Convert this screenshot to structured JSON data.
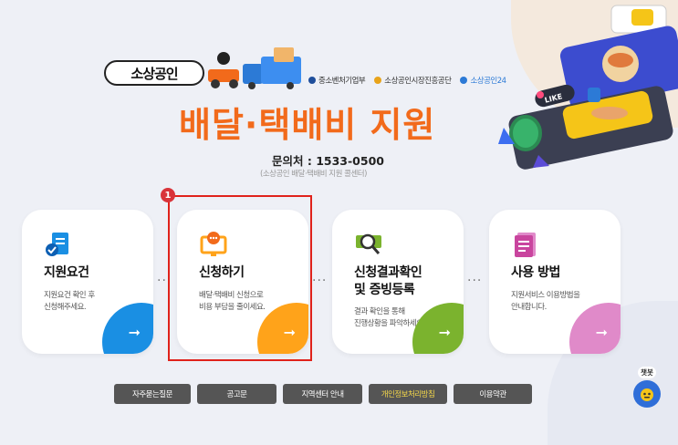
{
  "header": {
    "badge": "소상공인",
    "orgs": [
      {
        "label": "중소벤처기업부",
        "color": "#1f4e9b"
      },
      {
        "label": "소상공인시장진흥공단",
        "color": "#e8a31a"
      },
      {
        "label": "소상공인24",
        "color": "#2c7ad6"
      }
    ],
    "title": "배달·택배비 지원",
    "contact": "문의처 : 1533-0500",
    "contact_sub": "(소상공인 배달·택배비 지원 콜센터)"
  },
  "cards": [
    {
      "title": "지원요건",
      "desc": [
        "지원요건 확인 후",
        "신청해주세요."
      ],
      "accent": "#1a8fe3",
      "icon": "document-check-icon"
    },
    {
      "title": "신청하기",
      "desc": [
        "배달·택배비 신청으로",
        "비용 부담을 줄이세요."
      ],
      "accent": "#ffa31a",
      "icon": "monitor-chat-icon"
    },
    {
      "title": "신청결과확인",
      "title2": "및 증빙등록",
      "desc": [
        "결과 확인을 통해",
        "진행상황을 파악하세요."
      ],
      "accent": "#7bb32e",
      "icon": "magnifier-icon"
    },
    {
      "title": "사용 방법",
      "desc": [
        "지원서비스 이용방법을",
        "안내합니다."
      ],
      "accent": "#e08ac9",
      "icon": "notebook-icon"
    }
  ],
  "annotation": {
    "step": "1"
  },
  "buttons": [
    {
      "label": "자주묻는질문",
      "active": false
    },
    {
      "label": "공고문",
      "active": false
    },
    {
      "label": "지역센터 안내",
      "active": false
    },
    {
      "label": "개인정보처리방침",
      "active": true
    },
    {
      "label": "이용약관",
      "active": false
    }
  ],
  "chatbot": {
    "label": "챗봇"
  },
  "deco": {
    "like": "LIKE"
  },
  "arrow_glyph": "➞",
  "dots_glyph": "···"
}
